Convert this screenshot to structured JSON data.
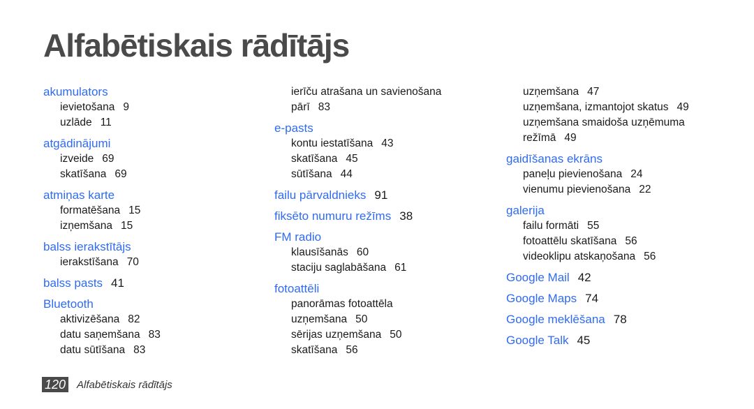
{
  "page_title": "Alfabētiskais rādītājs",
  "footer": {
    "page_number": "120",
    "section": "Alfabētiskais rādītājs"
  },
  "columns": [
    [
      {
        "term": "akumulators",
        "page": "",
        "subs": [
          {
            "t": "ievietošana",
            "p": "9"
          },
          {
            "t": "uzlāde",
            "p": "11"
          }
        ]
      },
      {
        "term": "atgādinājumi",
        "page": "",
        "subs": [
          {
            "t": "izveide",
            "p": "69"
          },
          {
            "t": "skatīšana",
            "p": "69"
          }
        ]
      },
      {
        "term": "atmiņas karte",
        "page": "",
        "subs": [
          {
            "t": "formatēšana",
            "p": "15"
          },
          {
            "t": "izņemšana",
            "p": "15"
          }
        ]
      },
      {
        "term": "balss ierakstītājs",
        "page": "",
        "subs": [
          {
            "t": "ierakstīšana",
            "p": "70"
          }
        ]
      },
      {
        "term": "balss pasts",
        "page": "41",
        "subs": []
      },
      {
        "term": "Bluetooth",
        "page": "",
        "subs": [
          {
            "t": "aktivizēšana",
            "p": "82"
          },
          {
            "t": "datu saņemšana",
            "p": "83"
          },
          {
            "t": "datu sūtīšana",
            "p": "83"
          }
        ]
      }
    ],
    [
      {
        "term": "",
        "page": "",
        "subs": [
          {
            "t": "ierīču atrašana un savienošana",
            "p": ""
          },
          {
            "t": "pārī",
            "p": "83"
          }
        ]
      },
      {
        "term": "e-pasts",
        "page": "",
        "subs": [
          {
            "t": "kontu iestatīšana",
            "p": "43"
          },
          {
            "t": "skatīšana",
            "p": "45"
          },
          {
            "t": "sūtīšana",
            "p": "44"
          }
        ]
      },
      {
        "term": "failu pārvaldnieks",
        "page": "91",
        "subs": []
      },
      {
        "term": "fiksēto numuru režīms",
        "page": "38",
        "subs": []
      },
      {
        "term": "FM radio",
        "page": "",
        "subs": [
          {
            "t": "klausīšanās",
            "p": "60"
          },
          {
            "t": "staciju saglabāšana",
            "p": "61"
          }
        ]
      },
      {
        "term": "fotoattēli",
        "page": "",
        "subs": [
          {
            "t": "panorāmas fotoattēla",
            "p": ""
          },
          {
            "t": "uzņemšana",
            "p": "50"
          },
          {
            "t": "sērijas uzņemšana",
            "p": "50"
          },
          {
            "t": "skatīšana",
            "p": "56"
          }
        ]
      }
    ],
    [
      {
        "term": "",
        "page": "",
        "subs": [
          {
            "t": "uzņemšana",
            "p": "47"
          },
          {
            "t": "uzņemšana, izmantojot skatus",
            "p": "49"
          },
          {
            "t": "uzņemšana smaidoša uzņēmuma",
            "p": ""
          },
          {
            "t": "režīmā",
            "p": "49"
          }
        ]
      },
      {
        "term": "gaidīšanas ekrāns",
        "page": "",
        "subs": [
          {
            "t": "paneļu pievienošana",
            "p": "24"
          },
          {
            "t": "vienumu pievienošana",
            "p": "22"
          }
        ]
      },
      {
        "term": "galerija",
        "page": "",
        "subs": [
          {
            "t": "failu formāti",
            "p": "55"
          },
          {
            "t": "fotoattēlu skatīšana",
            "p": "56"
          },
          {
            "t": "videoklipu atskaņošana",
            "p": "56"
          }
        ]
      },
      {
        "term": "Google Mail",
        "page": "42",
        "subs": []
      },
      {
        "term": "Google Maps",
        "page": "74",
        "subs": []
      },
      {
        "term": "Google meklēšana",
        "page": "78",
        "subs": []
      },
      {
        "term": "Google Talk",
        "page": "45",
        "subs": []
      }
    ]
  ],
  "colors": {
    "heading": "#2f6bf2",
    "title": "#4a4a4a",
    "text": "#1a1a1a"
  }
}
